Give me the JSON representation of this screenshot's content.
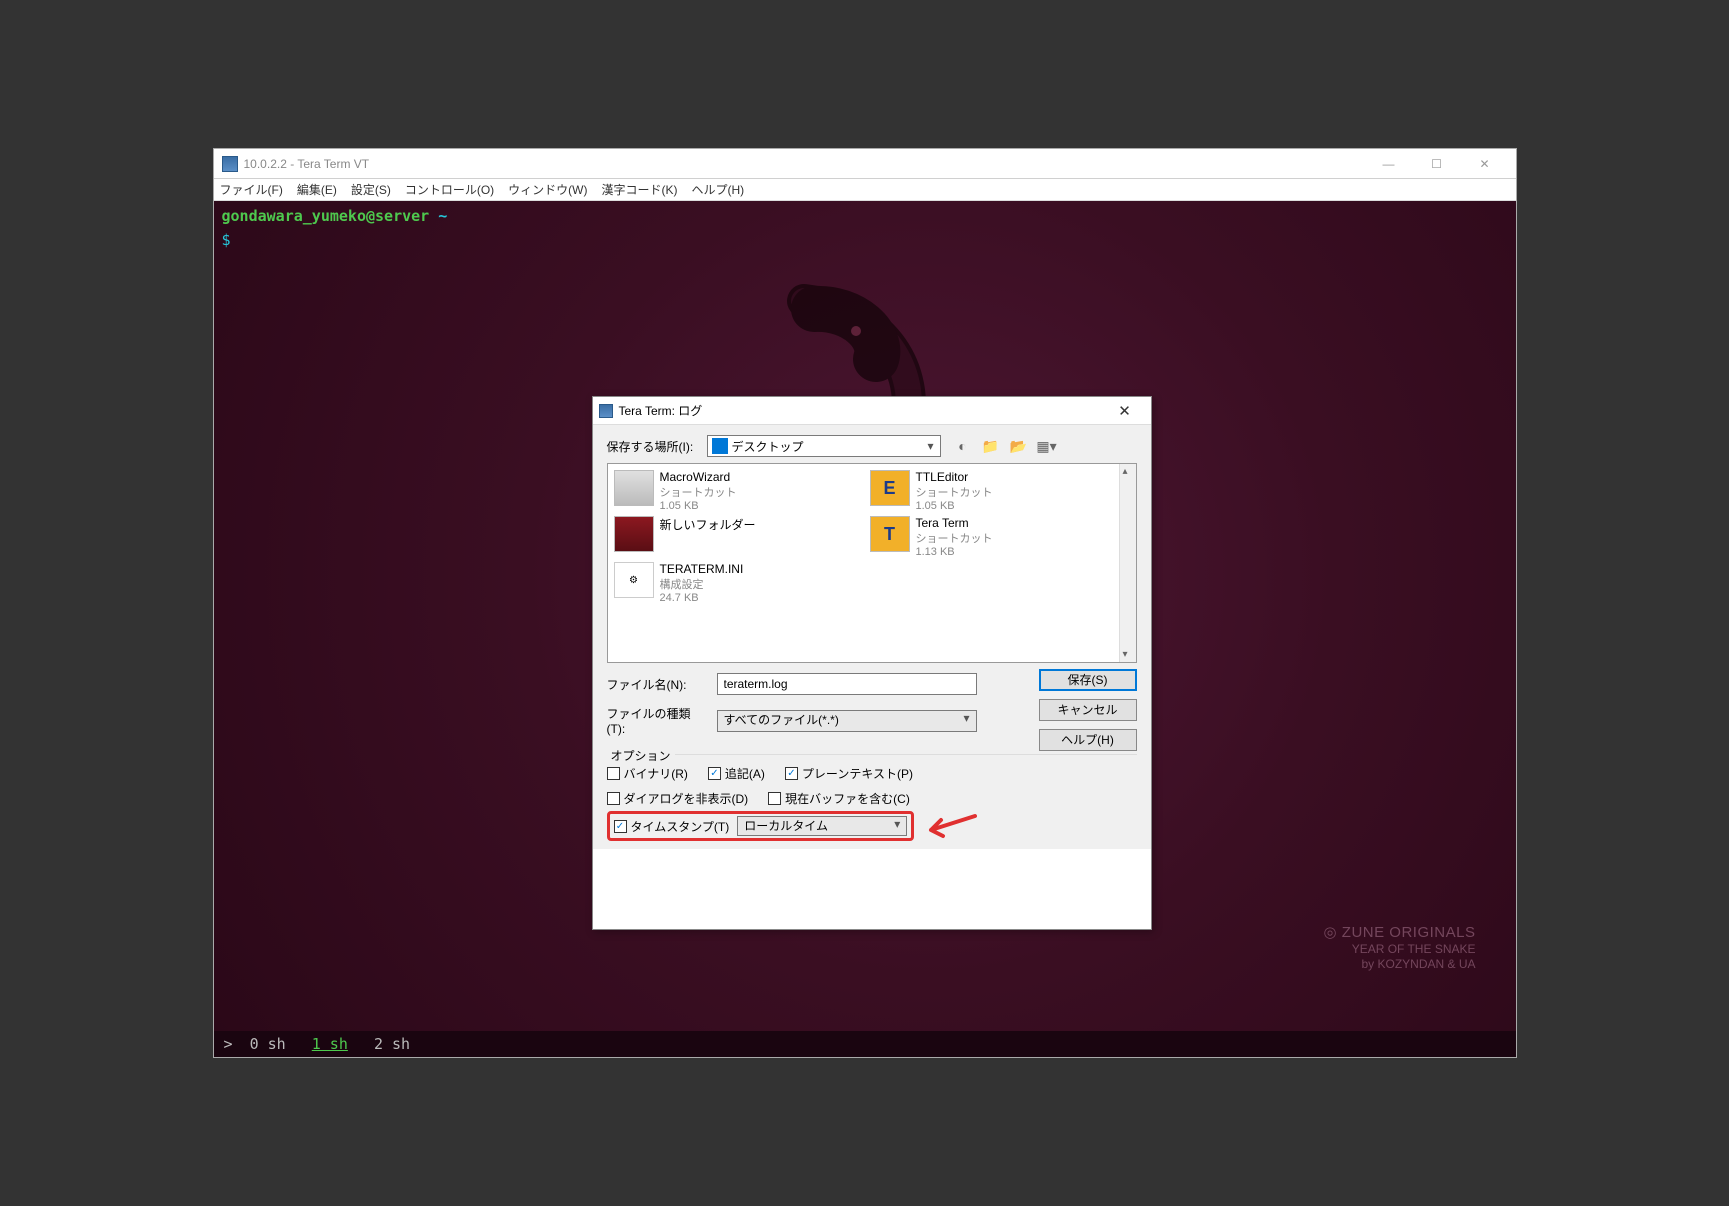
{
  "window": {
    "title": "10.0.2.2 - Tera Term VT",
    "menus": [
      "ファイル(F)",
      "編集(E)",
      "設定(S)",
      "コントロール(O)",
      "ウィンドウ(W)",
      "漢字コード(K)",
      "ヘルプ(H)"
    ]
  },
  "terminal": {
    "prompt_user": "gondawara_yumeko",
    "prompt_at": "@",
    "prompt_host": "server",
    "prompt_tilde": " ~",
    "prompt_symbol": "$"
  },
  "statusbar": {
    "caret": ">",
    "s0": "0 sh",
    "s1": "1 sh",
    "s2": "2 sh"
  },
  "watermark": {
    "brand_prefix": "◎ ",
    "brand": "ZUNE",
    "brand_suffix": " ORIGINALS",
    "line2": "YEAR OF THE SNAKE",
    "line3": "by KOZYNDAN & UA"
  },
  "dialog": {
    "title": "Tera Term: ログ",
    "save_in_label": "保存する場所(I):",
    "save_in_value": "デスクトップ",
    "nav_icons": {
      "back": "back-icon",
      "up": "up-icon",
      "new": "new-folder-icon",
      "view": "view-menu-icon"
    },
    "files": [
      {
        "name": "MacroWizard",
        "sub1": "ショートカット",
        "sub2": "1.05 KB",
        "icon": "pc"
      },
      {
        "name": "TTLEditor",
        "sub1": "ショートカット",
        "sub2": "1.05 KB",
        "icon": "e"
      },
      {
        "name": "新しいフォルダー",
        "sub1": "",
        "sub2": "",
        "icon": "folder"
      },
      {
        "name": "Tera Term",
        "sub1": "ショートカット",
        "sub2": "1.13 KB",
        "icon": "t"
      },
      {
        "name": "TERATERM.INI",
        "sub1": "構成設定",
        "sub2": "24.7 KB",
        "icon": "ini"
      }
    ],
    "filename_label": "ファイル名(N):",
    "filename_value": "teraterm.log",
    "filetype_label": "ファイルの種類(T):",
    "filetype_value": "すべてのファイル(*.*)",
    "btn_save": "保存(S)",
    "btn_cancel": "キャンセル",
    "btn_help": "ヘルプ(H)",
    "options_title": "オプション",
    "opt_binary": "バイナリ(R)",
    "opt_append": "追記(A)",
    "opt_plaintext": "プレーンテキスト(P)",
    "opt_hidedialog": "ダイアログを非表示(D)",
    "opt_includebuffer": "現在バッファを含む(C)",
    "opt_timestamp": "タイムスタンプ(T)",
    "timestamp_value": "ローカルタイム",
    "checked": {
      "binary": false,
      "append": true,
      "plaintext": true,
      "hidedialog": false,
      "includebuffer": false,
      "timestamp": true
    }
  }
}
